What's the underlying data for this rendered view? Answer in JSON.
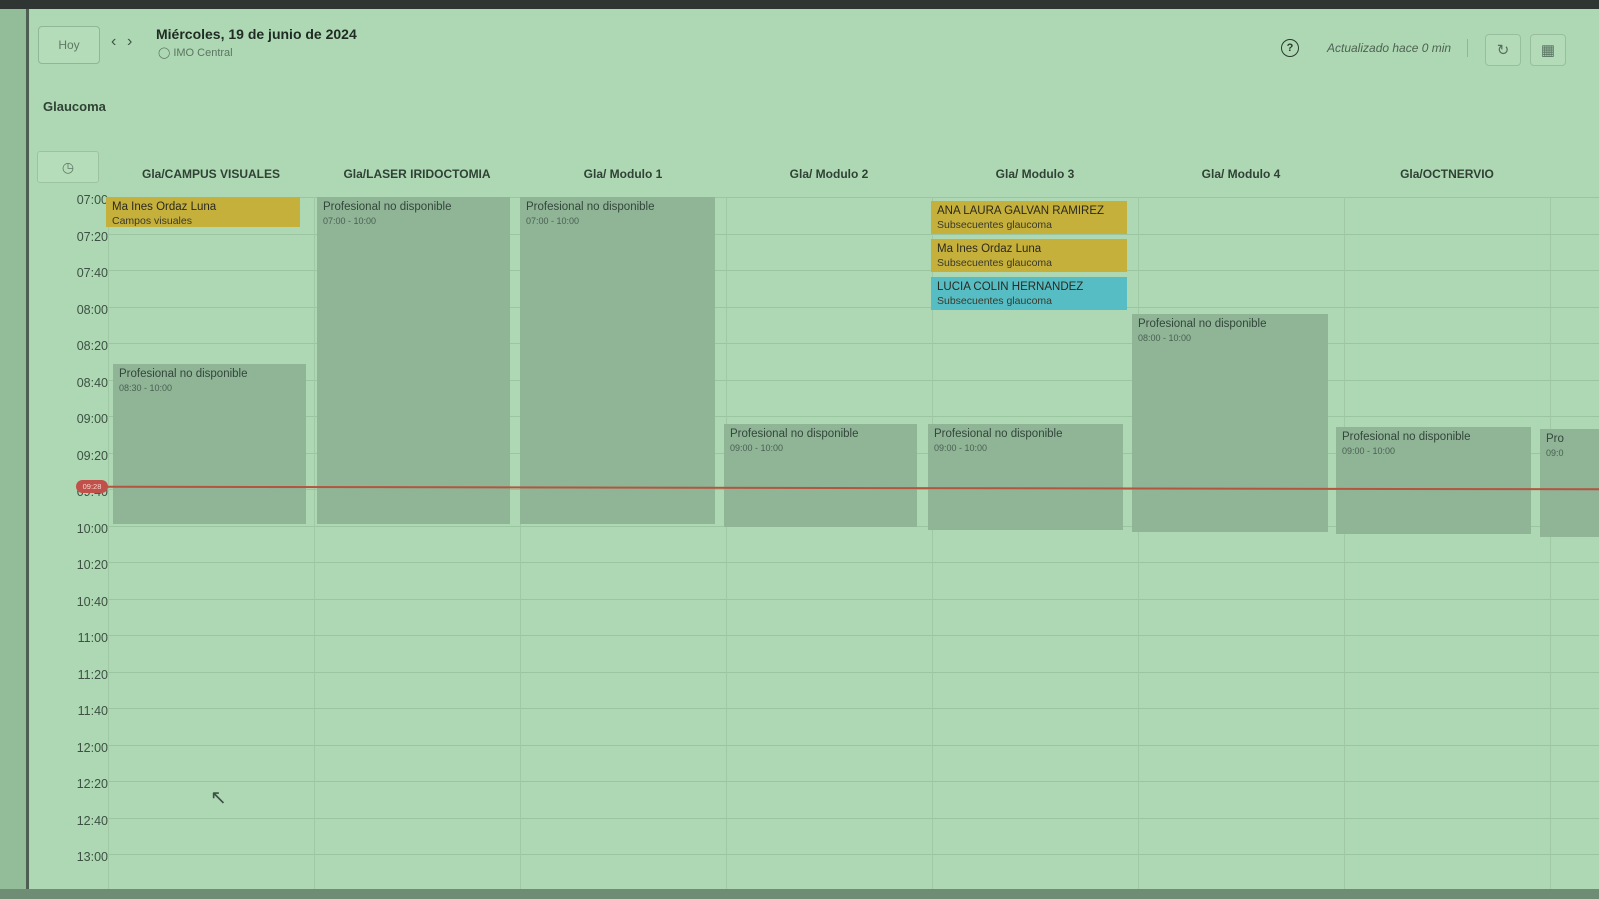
{
  "header": {
    "today_label": "Hoy",
    "prev_icon": "chevron-left-icon",
    "next_icon": "chevron-right-icon",
    "date": "Miércoles, 19 de junio de 2024",
    "location": "IMO Central",
    "updated_text": "Actualizado hace 0 min",
    "help_icon": "help-icon",
    "refresh_icon": "refresh-icon",
    "layout_icon": "layout-icon"
  },
  "section_title": "Glaucoma",
  "columns": [
    {
      "name": "Gla/CAMPUS VISUALES"
    },
    {
      "name": "Gla/LASER IRIDOCTOMIA"
    },
    {
      "name": "Gla/ Modulo 1"
    },
    {
      "name": "Gla/ Modulo 2"
    },
    {
      "name": "Gla/ Modulo 3"
    },
    {
      "name": "Gla/ Modulo 4"
    },
    {
      "name": "Gla/OCTNERVIO"
    }
  ],
  "times": [
    "07:00",
    "07:20",
    "07:40",
    "08:00",
    "08:20",
    "08:40",
    "09:00",
    "09:20",
    "09:40",
    "10:00",
    "10:20",
    "10:40",
    "11:00",
    "11:20",
    "11:40",
    "12:00",
    "12:20",
    "12:40",
    "13:00"
  ],
  "now_label": "09:28",
  "appointments": [
    {
      "name": "Ma Ines Ordaz Luna",
      "service": "Campos visuales",
      "color": "#c6b03c"
    },
    {
      "name": "ANA LAURA GALVAN RAMIREZ",
      "service": "Subsecuentes glaucoma",
      "color": "#c6b03c"
    },
    {
      "name": "Ma Ines Ordaz Luna",
      "service": "Subsecuentes glaucoma",
      "color": "#c6b03c"
    },
    {
      "name": "LUCIA COLIN HERNANDEZ",
      "service": "Subsecuentes glaucoma",
      "color": "#57bdc5"
    }
  ],
  "unavailable": [
    {
      "title": "Profesional no disponible",
      "range": "08:30 - 10:00"
    },
    {
      "title": "Profesional no disponible",
      "range": "07:00 - 10:00"
    },
    {
      "title": "Profesional no disponible",
      "range": "07:00 - 10:00"
    },
    {
      "title": "Profesional no disponible",
      "range": "09:00 - 10:00"
    },
    {
      "title": "Profesional no disponible",
      "range": "09:00 - 10:00"
    },
    {
      "title": "Profesional no disponible",
      "range": "08:00 - 10:00"
    },
    {
      "title": "Profesional no disponible",
      "range": "09:00 - 10:00"
    },
    {
      "title": "Pro",
      "range": "09:0"
    }
  ]
}
